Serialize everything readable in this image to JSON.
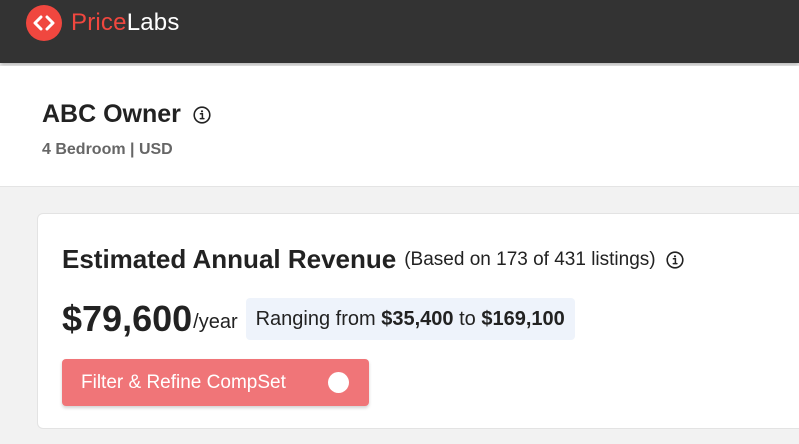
{
  "brand": {
    "name_part1": "Price",
    "name_part2": "Labs",
    "logo_icon": "code-brackets-icon",
    "accent_color": "#f0473f",
    "topbar_color": "#333333"
  },
  "listing": {
    "name": "ABC Owner",
    "details": "4 Bedroom | USD",
    "info_icon": "info-circle-icon"
  },
  "revenue": {
    "title": "Estimated Annual Revenue",
    "basis_note": "(Based on 173 of 431 listings)",
    "amount": "$79,600",
    "unit": "/year",
    "range_prefix": "Ranging from ",
    "range_low": "$35,400",
    "range_mid": " to ",
    "range_high": "$169,100",
    "range_bg_color": "#eef3fb"
  },
  "filter_button": {
    "label": "Filter & Refine CompSet",
    "toggle_state": "off",
    "color": "#f07578"
  }
}
